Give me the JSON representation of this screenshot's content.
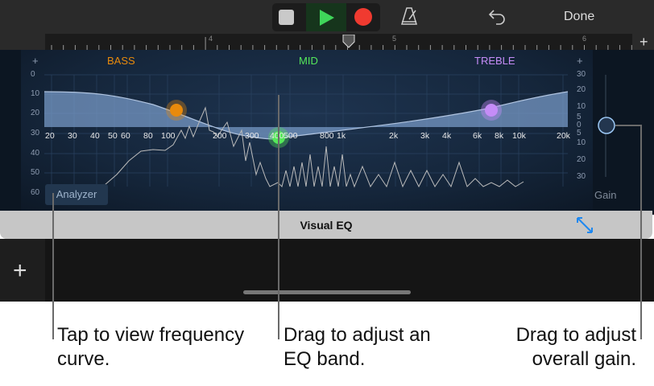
{
  "toolbar": {
    "done_label": "Done",
    "icons": [
      "stop-icon",
      "play-icon",
      "record-icon",
      "metronome-icon",
      "undo-icon"
    ]
  },
  "ruler": {
    "bars": [
      "4",
      "5",
      "6"
    ],
    "add_label": "+"
  },
  "eq": {
    "bands": {
      "bass": "BASS",
      "mid": "MID",
      "treble": "TREBLE"
    },
    "colors": {
      "bass": "#e88a0c",
      "mid": "#55e85a",
      "treble": "#c58cf7"
    },
    "plus": "+",
    "left_scale": [
      "0",
      "10",
      "20",
      "30",
      "40",
      "50",
      "60"
    ],
    "right_scale": [
      "30",
      "20",
      "10",
      "5",
      "0",
      "5",
      "10",
      "20",
      "30"
    ],
    "freqs": [
      "20",
      "30",
      "40",
      "50",
      "60",
      "80",
      "100",
      "200",
      "300",
      "400",
      "500",
      "800",
      "1k",
      "2k",
      "3k",
      "4k",
      "6k",
      "8k",
      "10k",
      "20k"
    ],
    "analyzer_label": "Analyzer",
    "gain_label": "Gain",
    "title": "Visual EQ"
  },
  "tracks": {
    "add_label": "+"
  },
  "callouts": {
    "analyzer": "Tap to view frequency curve.",
    "band": "Drag to adjust an EQ band.",
    "gain": "Drag to adjust overall gain."
  }
}
